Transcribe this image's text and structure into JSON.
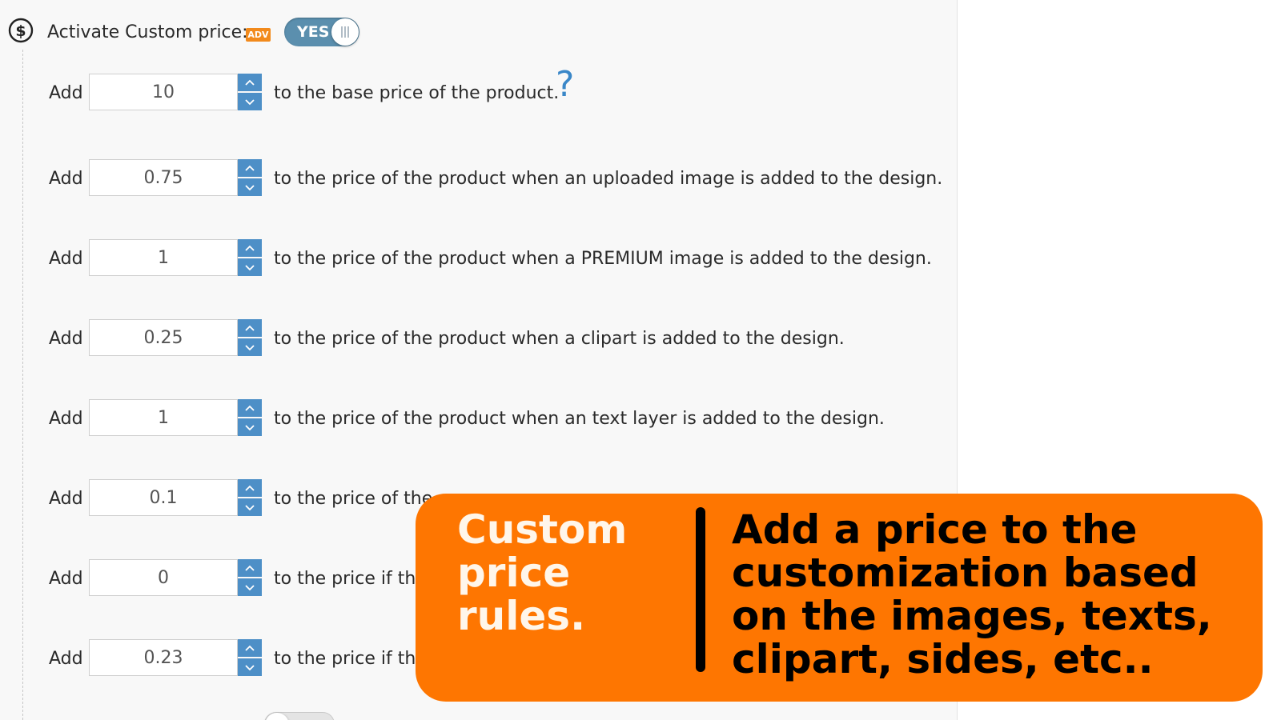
{
  "header": {
    "label": "Activate Custom price:",
    "badge": "ADV",
    "toggle_label": "YES"
  },
  "rows": [
    {
      "add_label": "Add",
      "value": "10",
      "description": "to the base price of the product."
    },
    {
      "add_label": "Add",
      "value": "0.75",
      "description": "to the price of the product when an uploaded image is added to the design."
    },
    {
      "add_label": "Add",
      "value": "1",
      "description": "to the price of the product when a PREMIUM image is added to the design."
    },
    {
      "add_label": "Add",
      "value": "0.25",
      "description": "to the price of the product when a clipart is added to the design."
    },
    {
      "add_label": "Add",
      "value": "1",
      "description": "to the price of the product when an text layer is added to the design."
    },
    {
      "add_label": "Add",
      "value": "0.1",
      "description": "to the price of the"
    },
    {
      "add_label": "Add",
      "value": "0",
      "description": "to the price if the"
    },
    {
      "add_label": "Add",
      "value": "0.23",
      "description": "to the price if the"
    }
  ],
  "help_icon_glyph": "?",
  "banner": {
    "title": "Custom\nprice rules.",
    "text": "Add a price to the customization based on the images, texts, clipart, sides, etc..",
    "background": "#fe7601"
  },
  "colors": {
    "accent_blue": "#4d8fc7",
    "toggle_on": "#5b8fae",
    "badge_orange": "#f28a1c"
  }
}
